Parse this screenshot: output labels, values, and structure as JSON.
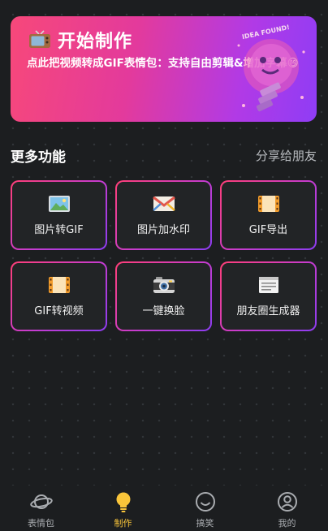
{
  "banner": {
    "title": "开始制作",
    "subtitle": "点此把视频转成GIF表情包：支持自由剪辑&增加字幕😄",
    "art_text": "IDEA FOUND!",
    "gradient": [
      "#f7487a",
      "#8f3df5"
    ]
  },
  "section": {
    "title": "更多功能",
    "share_label": "分享给朋友"
  },
  "features": [
    {
      "label": "图片转GIF",
      "icon": "image-icon"
    },
    {
      "label": "图片加水印",
      "icon": "envelope-icon"
    },
    {
      "label": "GIF导出",
      "icon": "film-icon"
    },
    {
      "label": "GIF转视频",
      "icon": "film-icon"
    },
    {
      "label": "一键换脸",
      "icon": "camera-icon"
    },
    {
      "label": "朋友圈生成器",
      "icon": "document-icon"
    }
  ],
  "tabs": [
    {
      "label": "表情包",
      "icon": "planet-icon",
      "active": false
    },
    {
      "label": "制作",
      "icon": "lightbulb-icon",
      "active": true
    },
    {
      "label": "搞笑",
      "icon": "smiley-icon",
      "active": false
    },
    {
      "label": "我的",
      "icon": "user-icon",
      "active": false
    }
  ],
  "colors": {
    "background": "#1c1e20",
    "active_tab": "#f9c53a",
    "card_border_start": "#ff3f77",
    "card_border_end": "#8c3df0"
  }
}
